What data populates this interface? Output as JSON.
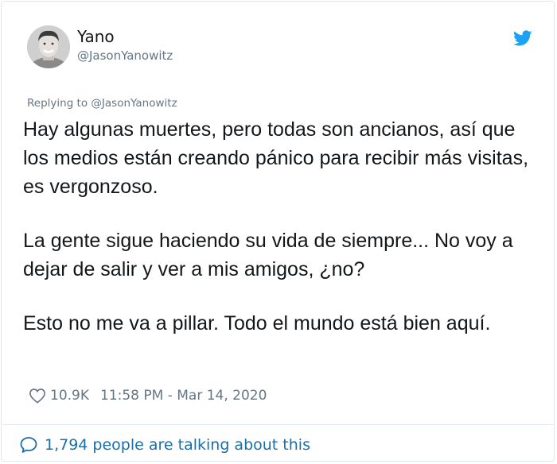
{
  "author": {
    "name": "Yano",
    "handle": "@JasonYanowitz"
  },
  "icons": {
    "brand": "twitter-bird-icon",
    "like": "heart-icon",
    "conversation": "speech-bubble-icon"
  },
  "colors": {
    "twitter_blue": "#1da1f2",
    "secondary_text": "#657786",
    "link": "#1b6fa8"
  },
  "tweet": {
    "replying_to": "Replying to @JasonYanowitz",
    "paragraphs": [
      "Hay algunas muertes, pero todas son ancianos, así que los medios están creando pánico para recibir más visitas, es vergonzoso.",
      "La gente sigue haciendo su vida de siempre... No voy a dejar de salir y ver a mis amigos, ¿no?",
      "Esto no me va a pillar. Todo el mundo está bien aquí."
    ],
    "likes": "10.9K",
    "timestamp": "11:58 PM - Mar 14, 2020"
  },
  "footer": {
    "talking": "1,794 people are talking about this"
  }
}
